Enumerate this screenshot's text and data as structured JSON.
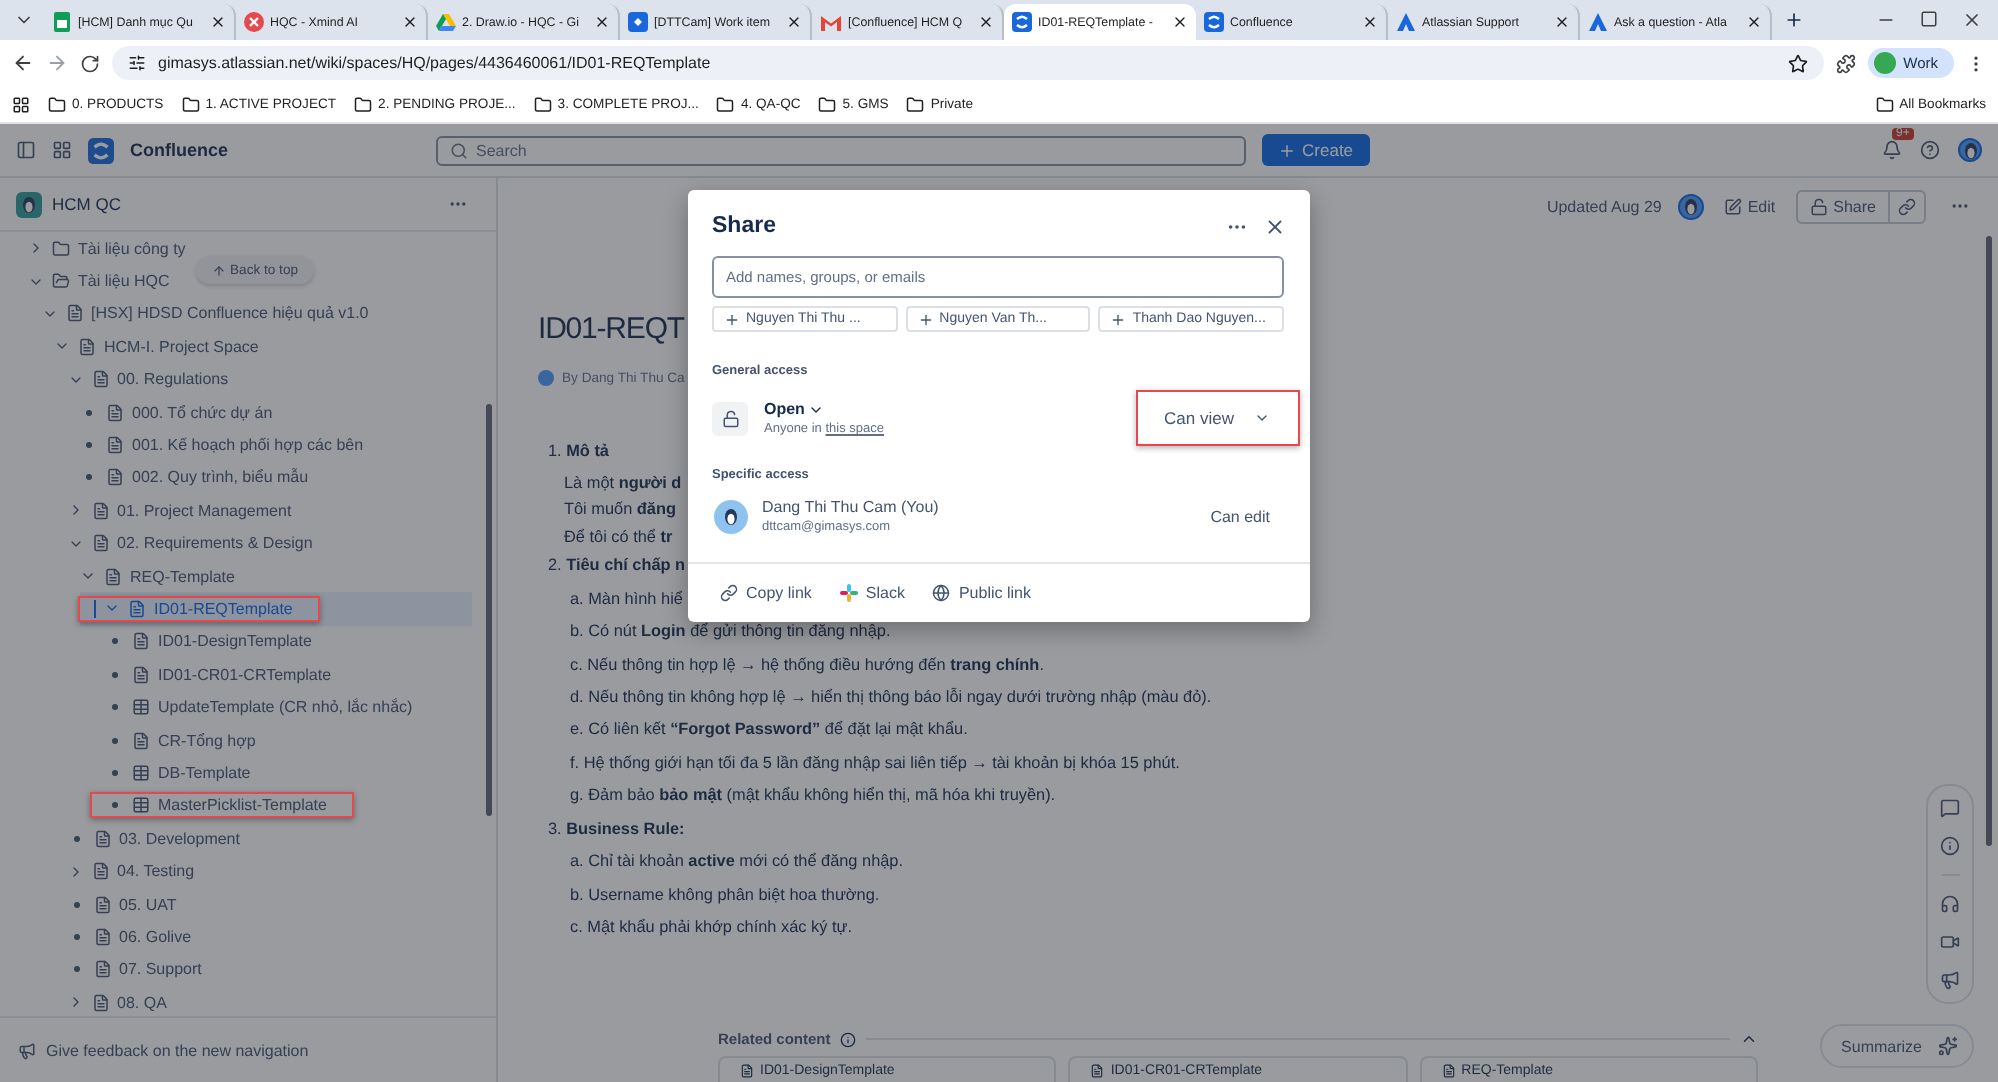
{
  "browser": {
    "tabs": [
      {
        "title": "[HCM] Danh mục Qu",
        "kind": "sheet",
        "selected": false
      },
      {
        "title": "HQC - Xmind AI",
        "kind": "xmind",
        "selected": false
      },
      {
        "title": "2. Draw.io - HQC - Gi",
        "kind": "drive",
        "selected": false
      },
      {
        "title": "[DTTCam] Work item",
        "kind": "jira",
        "selected": false
      },
      {
        "title": "[Confluence] HCM Q",
        "kind": "mail",
        "selected": false
      },
      {
        "title": "ID01-REQTemplate -",
        "kind": "confluence",
        "selected": true
      },
      {
        "title": "Confluence",
        "kind": "confluence",
        "selected": false
      },
      {
        "title": "Atlassian Support",
        "kind": "atlassian",
        "selected": false
      },
      {
        "title": "Ask a question - Atla",
        "kind": "atlassian",
        "selected": false
      }
    ],
    "address": "gimasys.atlassian.net/wiki/spaces/HQ/pages/4436460061/ID01-REQTemplate",
    "profile": "Work",
    "bookmarks": [
      "0. PRODUCTS",
      "1. ACTIVE PROJECT",
      "2. PENDING PROJE...",
      "3. COMPLETE PROJ...",
      "4. QA-QC",
      "5. GMS",
      "Private"
    ],
    "all_bookmarks": "All Bookmarks"
  },
  "app": {
    "name": "Confluence",
    "search": {
      "placeholder": "Search"
    },
    "create": "Create",
    "notifications": "9+"
  },
  "sidebar": {
    "space": "HCM QC",
    "back_to_top": "Back to top",
    "feedback": "Give feedback on the new navigation",
    "tree": [
      {
        "label": "Tài liệu công ty",
        "kind": "folder",
        "expandable": true,
        "expanded": false,
        "selected": false,
        "highlighted": false
      },
      {
        "label": "Tài liệu HQC",
        "kind": "folder",
        "expandable": true,
        "expanded": true,
        "selected": false,
        "highlighted": false,
        "children": [
          {
            "label": "[HSX] HDSD Confluence hiệu quả v1.0",
            "kind": "page",
            "expandable": true,
            "expanded": true,
            "selected": false,
            "highlighted": false,
            "children": [
              {
                "label": "HCM-I. Project Space",
                "kind": "page",
                "expandable": true,
                "expanded": true,
                "selected": false,
                "highlighted": false,
                "children": [
                  {
                    "label": "00. Regulations",
                    "kind": "page",
                    "expandable": true,
                    "expanded": true,
                    "selected": false,
                    "highlighted": false,
                    "children": [
                      {
                        "label": "000. Tổ chức dự án",
                        "kind": "page",
                        "expandable": false,
                        "selected": false,
                        "highlighted": false
                      },
                      {
                        "label": "001. Kế hoạch phối hợp các bên",
                        "kind": "page",
                        "expandable": false,
                        "selected": false,
                        "highlighted": false
                      },
                      {
                        "label": "002. Quy trình, biểu mẫu",
                        "kind": "page",
                        "expandable": false,
                        "selected": false,
                        "highlighted": false
                      }
                    ]
                  },
                  {
                    "label": "01. Project Management",
                    "kind": "page",
                    "expandable": true,
                    "expanded": false,
                    "selected": false,
                    "highlighted": false
                  },
                  {
                    "label": "02. Requirements & Design",
                    "kind": "page",
                    "expandable": true,
                    "expanded": true,
                    "selected": false,
                    "highlighted": false,
                    "children": [
                      {
                        "label": "REQ-Template",
                        "kind": "page",
                        "expandable": true,
                        "expanded": true,
                        "selected": false,
                        "highlighted": false,
                        "children": [
                          {
                            "label": "ID01-REQTemplate",
                            "kind": "page",
                            "expandable": true,
                            "expanded": true,
                            "selected": true,
                            "highlighted": true,
                            "children": [
                              {
                                "label": "ID01-DesignTemplate",
                                "kind": "page",
                                "expandable": false,
                                "selected": false,
                                "highlighted": false
                              },
                              {
                                "label": "ID01-CR01-CRTemplate",
                                "kind": "page",
                                "expandable": false,
                                "selected": false,
                                "highlighted": false
                              },
                              {
                                "label": "UpdateTemplate (CR nhỏ, lắc nhắc)",
                                "kind": "database",
                                "expandable": false,
                                "selected": false,
                                "highlighted": false
                              },
                              {
                                "label": "CR-Tổng hợp",
                                "kind": "page",
                                "expandable": false,
                                "selected": false,
                                "highlighted": false
                              },
                              {
                                "label": "DB-Template",
                                "kind": "database",
                                "expandable": false,
                                "selected": false,
                                "highlighted": false
                              },
                              {
                                "label": "MasterPicklist-Template",
                                "kind": "database",
                                "expandable": false,
                                "selected": false,
                                "highlighted": true
                              }
                            ]
                          }
                        ]
                      }
                    ]
                  },
                  {
                    "label": "03. Development",
                    "kind": "page",
                    "expandable": false,
                    "selected": false,
                    "highlighted": false
                  },
                  {
                    "label": "04. Testing",
                    "kind": "page",
                    "expandable": true,
                    "expanded": false,
                    "selected": false,
                    "highlighted": false
                  },
                  {
                    "label": "05. UAT",
                    "kind": "page",
                    "expandable": false,
                    "selected": false,
                    "highlighted": false
                  },
                  {
                    "label": "06. Golive",
                    "kind": "page",
                    "expandable": false,
                    "selected": false,
                    "highlighted": false
                  },
                  {
                    "label": "07. Support",
                    "kind": "page",
                    "expandable": false,
                    "selected": false,
                    "highlighted": false
                  },
                  {
                    "label": "08. QA",
                    "kind": "page",
                    "expandable": true,
                    "expanded": false,
                    "selected": false,
                    "highlighted": false
                  }
                ]
              }
            ]
          }
        ]
      }
    ]
  },
  "page": {
    "updated": "Updated Aug 29",
    "edit": "Edit",
    "share": "Share",
    "title": "ID01-REQT",
    "byline": "By Dang Thi Thu Ca",
    "lines": [
      {
        "kind": "section",
        "text": "1. **Mô tả**"
      },
      {
        "kind": "line",
        "text": "Là một **người d**"
      },
      {
        "kind": "line",
        "text": "Tôi muốn **đăng**"
      },
      {
        "kind": "line",
        "text": "Để tôi có thể **tr**"
      },
      {
        "kind": "section",
        "text": "2. **Tiêu chí chấp n**"
      },
      {
        "kind": "item",
        "text": "a. Màn hình hiể"
      },
      {
        "kind": "item",
        "text": "b. Có nút **Login** để gửi thông tin đăng nhập."
      },
      {
        "kind": "item",
        "text": "c. Nếu thông tin hợp lệ → hệ thống điều hướng đến **trang chính**."
      },
      {
        "kind": "item",
        "text": "d. Nếu thông tin không hợp lệ → hiển thị thông báo lỗi ngay dưới trường nhập (màu đỏ)."
      },
      {
        "kind": "item",
        "text": "e. Có liên kết **“Forgot Password”** để đặt lại mật khẩu."
      },
      {
        "kind": "item",
        "text": "f. Hệ thống giới hạn tối đa 5 lần đăng nhập sai liên tiếp → tài khoản bị khóa 15 phút."
      },
      {
        "kind": "item",
        "text": "g. Đảm bảo **bảo mật** (mật khẩu không hiển thị, mã hóa khi truyền)."
      },
      {
        "kind": "section",
        "text": "3. **Business Rule:**"
      },
      {
        "kind": "item",
        "text": "a. Chỉ tài khoản **active** mới có thể đăng nhập."
      },
      {
        "kind": "item",
        "text": "b. Username không phân biệt hoa thường."
      },
      {
        "kind": "item",
        "text": "c. Mật khẩu phải khớp chính xác ký tự."
      }
    ],
    "related": {
      "title": "Related content",
      "cards": [
        "ID01-DesignTemplate",
        "ID01-CR01-CRTemplate",
        "REQ-Template"
      ]
    },
    "summarize": "Summarize"
  },
  "share_dialog": {
    "title": "Share",
    "input": {
      "placeholder": "Add names, groups, or emails"
    },
    "suggestions": [
      "Nguyen Thi Thu ...",
      "Nguyen Van Th...",
      "Thanh Dao Nguyen..."
    ],
    "general_access": {
      "heading": "General access",
      "mode": "Open",
      "note": "Anyone in",
      "note_link": "this space",
      "permission": "Can view",
      "highlighted": true
    },
    "specific_access": {
      "heading": "Specific access",
      "people": [
        {
          "name": "Dang Thi Thu Cam (You)",
          "email": "dttcam@gimasys.com",
          "role": "Can edit"
        }
      ]
    },
    "footer": [
      {
        "label": "Copy link",
        "kind": "link"
      },
      {
        "label": "Slack",
        "kind": "slack"
      },
      {
        "label": "Public link",
        "kind": "globe"
      }
    ]
  }
}
